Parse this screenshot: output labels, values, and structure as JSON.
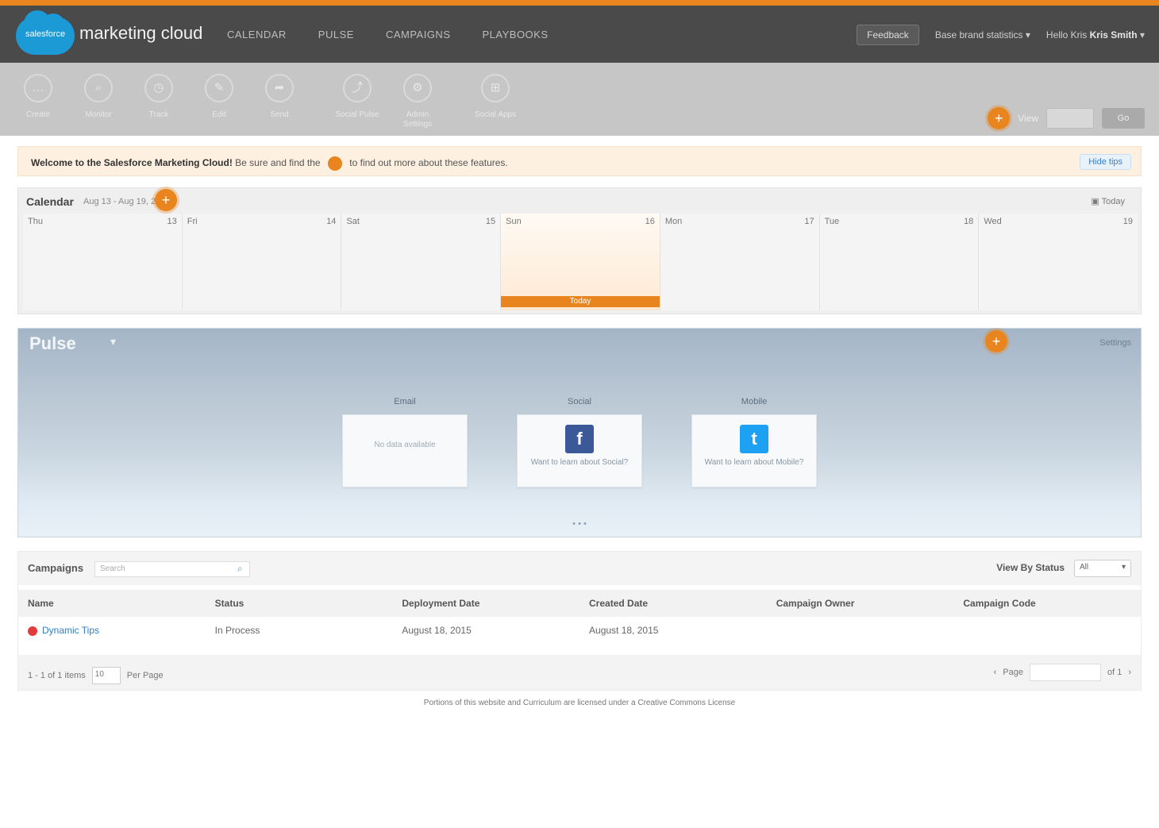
{
  "header": {
    "logo_text": "salesforce",
    "app_title": "marketing cloud",
    "nav": [
      "CALENDAR",
      "PULSE",
      "CAMPAIGNS",
      "PLAYBOOKS"
    ],
    "feedback_label": "Feedback",
    "business_unit": "Base brand statistics",
    "user_label": "Hello Kris",
    "user_name": "Kris Smith"
  },
  "toolbar": {
    "tools": [
      {
        "icon": "chat-icon",
        "glyph": "…",
        "label": "Create"
      },
      {
        "icon": "search-icon",
        "glyph": "⌕",
        "label": "Monitor"
      },
      {
        "icon": "clock-icon",
        "glyph": "◷",
        "label": "Track"
      },
      {
        "icon": "pencil-icon",
        "glyph": "✎",
        "label": "Edit"
      },
      {
        "icon": "send-icon",
        "glyph": "➦",
        "label": "Send"
      },
      {
        "icon": "chart-icon",
        "glyph": "⤴",
        "label": "Social Pulse"
      },
      {
        "icon": "gear-icon",
        "glyph": "⚙",
        "label": "Admin Settings"
      },
      {
        "icon": "grid-icon",
        "glyph": "⊞",
        "label": "Social Apps"
      }
    ],
    "right_label": "View",
    "right_button": "Go"
  },
  "welcome": {
    "bold_text": "Welcome to the Salesforce Marketing Cloud!",
    "text_a": "Be sure and find the",
    "text_b": "to find out more about these features.",
    "hide_label": "Hide tips"
  },
  "calendar": {
    "title": "Calendar",
    "range": "Aug 13 - Aug 19, 2015",
    "today_link": "Today",
    "days": [
      {
        "name": "Thu",
        "num": "13"
      },
      {
        "name": "Fri",
        "num": "14"
      },
      {
        "name": "Sat",
        "num": "15"
      },
      {
        "name": "Sun",
        "num": "16"
      },
      {
        "name": "Mon",
        "num": "17"
      },
      {
        "name": "Tue",
        "num": "18"
      },
      {
        "name": "Wed",
        "num": "19"
      }
    ],
    "today_bar": "Today"
  },
  "pulse": {
    "title": "Pulse",
    "settings_label": "Settings",
    "cards": [
      {
        "caption": "Email",
        "text": "No data available"
      },
      {
        "caption": "Social",
        "text": "Want to learn about Social?"
      },
      {
        "caption": "Mobile",
        "text": "Want to learn about Mobile?"
      }
    ],
    "footer": "• • •"
  },
  "campaigns": {
    "title": "Campaigns",
    "search_placeholder": "Search",
    "status_label": "View By Status",
    "status_value": "All",
    "columns": [
      "Name",
      "Status",
      "Deployment Date",
      "Created Date",
      "Campaign Owner",
      "Campaign Code"
    ],
    "rows": [
      {
        "name": "Dynamic Tips",
        "status": "In Process",
        "deployment": "August 18, 2015",
        "created": "August 18, 2015",
        "owner": "",
        "code": ""
      }
    ],
    "pager": {
      "range": "1 - 1 of 1 items",
      "per_page_value": "10",
      "per_page_label": "Per Page",
      "page_label": "Page",
      "of_label": "of 1"
    }
  },
  "footer": "Portions of this website and Curriculum are licensed under a Creative Commons License"
}
